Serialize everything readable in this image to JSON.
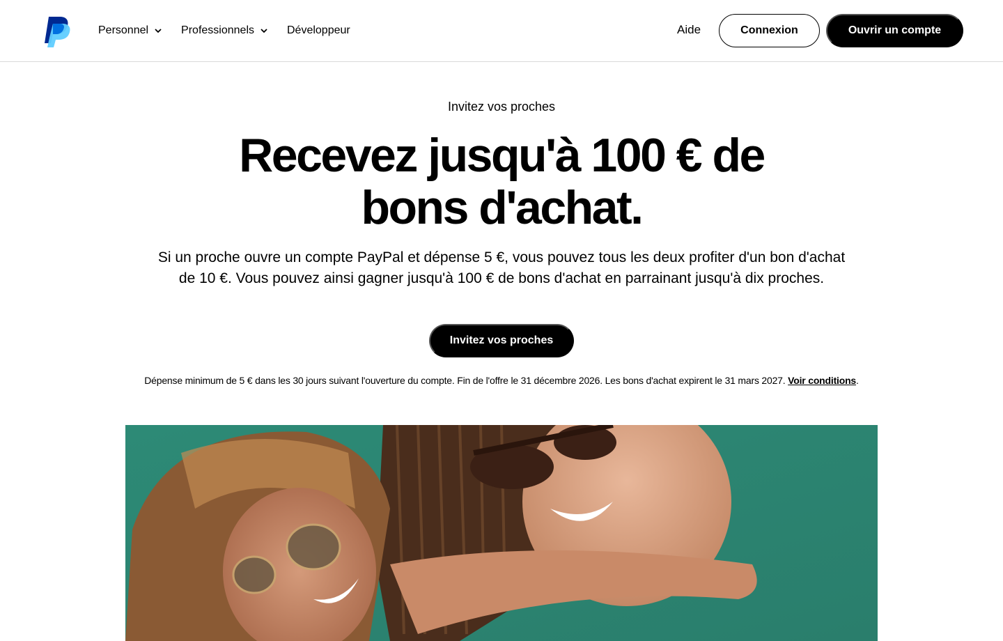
{
  "header": {
    "logo": "paypal-logo",
    "nav": [
      {
        "label": "Personnel",
        "has_dropdown": true
      },
      {
        "label": "Professionnels",
        "has_dropdown": true
      },
      {
        "label": "Développeur",
        "has_dropdown": false
      }
    ],
    "help_label": "Aide",
    "login_label": "Connexion",
    "signup_label": "Ouvrir un compte"
  },
  "hero": {
    "eyebrow": "Invitez vos proches",
    "headline_line1": "Recevez jusqu'à 100 € de",
    "headline_line2": "bons d'achat.",
    "description": "Si un proche ouvre un compte PayPal et dépense 5 €, vous pouvez tous les deux profiter d'un bon d'achat de 10 €. Vous pouvez ainsi gagner jusqu'à 100 € de bons d'achat en parrainant jusqu'à dix proches.",
    "cta_label": "Invitez vos proches",
    "legal_text": "Dépense minimum de 5 € dans les 30 jours suivant l'ouverture du compte. Fin de l'offre le 31 décembre 2026. Les bons d'achat expirent le 31 mars 2027. ",
    "legal_link": "Voir conditions",
    "legal_end": "."
  },
  "image": {
    "subject": "two-smiling-women-with-sunglasses"
  },
  "colors": {
    "primary": "#000000",
    "background": "#ffffff",
    "logo_dark": "#002991",
    "logo_light": "#60cdff"
  }
}
